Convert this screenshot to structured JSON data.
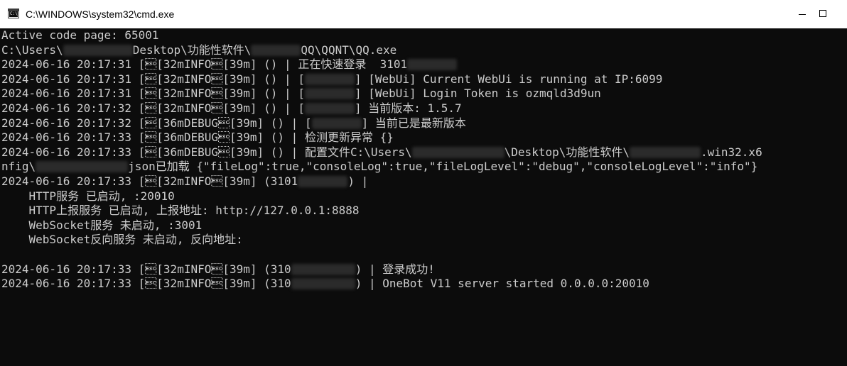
{
  "window": {
    "title": "C:\\WINDOWS\\system32\\cmd.exe",
    "icon_text": "C:\\",
    "icon": "console-app-icon",
    "controls": {
      "minimize": "minimize-icon",
      "maximize": "maximize-icon"
    }
  },
  "colors": {
    "background": "#0c0c0c",
    "text": "#cccccc",
    "titlebar": "#ffffff"
  },
  "console": {
    "lines": [
      {
        "text": "Active code page: 65001"
      },
      {
        "before": "C:\\Users\\",
        "after": "Desktop\\功能性软件\\",
        "after2": "QQ\\QQNT\\QQ.exe"
      },
      {
        "before": "2024-06-16 20:17:31 [\u001b[32mINFO\u001b[39m] () | 正在快速登录  3101",
        "after": ""
      },
      {
        "before": "2024-06-16 20:17:31 [\u001b[32mINFO\u001b[39m] () | [",
        "after": "] [WebUi] Current WebUi is running at IP:6099"
      },
      {
        "before": "2024-06-16 20:17:31 [\u001b[32mINFO\u001b[39m] () | [",
        "after": "] [WebUi] Login Token is ozmqld3d9un"
      },
      {
        "before": "2024-06-16 20:17:32 [\u001b[32mINFO\u001b[39m] () | [",
        "after": "] 当前版本: 1.5.7"
      },
      {
        "before": "2024-06-16 20:17:32 [\u001b[36mDEBUG\u001b[39m] () | [",
        "after": "] 当前已是最新版本"
      },
      {
        "text": "2024-06-16 20:17:33 [\u001b[36mDEBUG\u001b[39m] () | 检测更新异常 {}"
      },
      {
        "before": "2024-06-16 20:17:33 [\u001b[36mDEBUG\u001b[39m] () | 配置文件C:\\Users\\",
        "after": "\\Desktop\\功能性软件\\",
        "after2": ".win32.x6"
      },
      {
        "before": "nfig\\",
        "after": "json已加载 {\"fileLog\":true,\"consoleLog\":true,\"fileLogLevel\":\"debug\",\"consoleLogLevel\":\"info\"}"
      },
      {
        "before": "2024-06-16 20:17:33 [\u001b[32mINFO\u001b[39m] (3101",
        "after": ") |"
      },
      {
        "text": "    HTTP服务 已启动, :20010"
      },
      {
        "text": "    HTTP上报服务 已启动, 上报地址: http://127.0.0.1:8888"
      },
      {
        "text": "    WebSocket服务 未启动, :3001"
      },
      {
        "text": "    WebSocket反向服务 未启动, 反向地址:"
      },
      {
        "text": ""
      },
      {
        "before": "2024-06-16 20:17:33 [\u001b[32mINFO\u001b[39m] (310",
        "after": ") | 登录成功!"
      },
      {
        "before": "2024-06-16 20:17:33 [\u001b[32mINFO\u001b[39m] (310",
        "after": ") | OneBot V11 server started 0.0.0.0:20010"
      }
    ]
  }
}
